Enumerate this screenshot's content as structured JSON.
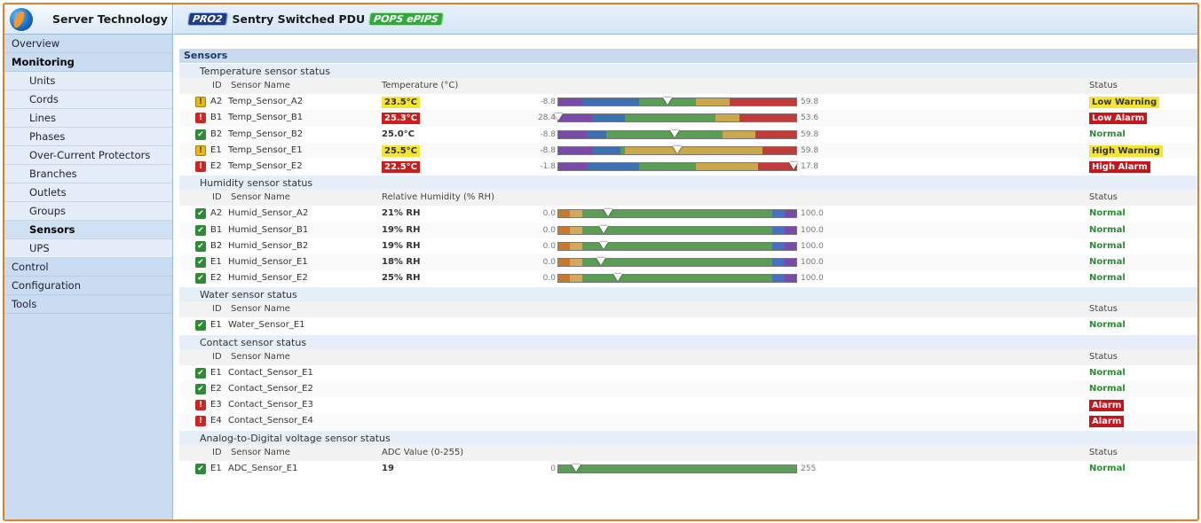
{
  "brand": {
    "name": "Server Technology"
  },
  "header": {
    "pro_badge": "PRO2",
    "product_title": "Sentry Switched PDU",
    "pips_badge": "POPS ePIPS"
  },
  "nav": [
    {
      "label": "Overview",
      "level": 0
    },
    {
      "label": "Monitoring",
      "level": 0,
      "active": true
    },
    {
      "label": "Units",
      "level": 1
    },
    {
      "label": "Cords",
      "level": 1
    },
    {
      "label": "Lines",
      "level": 1
    },
    {
      "label": "Phases",
      "level": 1
    },
    {
      "label": "Over-Current Protectors",
      "level": 1
    },
    {
      "label": "Branches",
      "level": 1
    },
    {
      "label": "Outlets",
      "level": 1
    },
    {
      "label": "Groups",
      "level": 1
    },
    {
      "label": "Sensors",
      "level": 1,
      "active": true
    },
    {
      "label": "UPS",
      "level": 1
    },
    {
      "label": "Control",
      "level": 0
    },
    {
      "label": "Configuration",
      "level": 0
    },
    {
      "label": "Tools",
      "level": 0
    }
  ],
  "sensors": {
    "title": "Sensors",
    "groups": [
      {
        "title": "Temperature sensor status",
        "headers": {
          "id": "ID",
          "name": "Sensor Name",
          "value": "Temperature (°C)",
          "status": "Status"
        },
        "rows": [
          {
            "icon": "warn",
            "id": "A2",
            "name": "Temp_Sensor_A2",
            "value": "23.5°C",
            "value_style": "warn",
            "min": "-8.8",
            "max": "59.8",
            "pointer_pct": 0.46,
            "bar": [
              [
                "#7a4aa8",
                0.1
              ],
              [
                "#3f6fb3",
                0.24
              ],
              [
                "#5a9e55",
                0.24
              ],
              [
                "#c8a84a",
                0.14
              ],
              [
                "#c33a3a",
                0.28
              ]
            ],
            "status": "Low Warning",
            "status_style": "lowwarn"
          },
          {
            "icon": "alarm",
            "id": "B1",
            "name": "Temp_Sensor_B1",
            "value": "25.3°C",
            "value_style": "alarm",
            "min": "28.4",
            "max": "53.6",
            "pointer_pct": 0.0,
            "bar": [
              [
                "#7a4aa8",
                0.14
              ],
              [
                "#3f6fb3",
                0.14
              ],
              [
                "#5a9e55",
                0.38
              ],
              [
                "#c8a84a",
                0.1
              ],
              [
                "#c33a3a",
                0.24
              ]
            ],
            "status": "Low Alarm",
            "status_style": "lowalarm"
          },
          {
            "icon": "ok",
            "id": "B2",
            "name": "Temp_Sensor_B2",
            "value": "25.0°C",
            "value_style": "plain",
            "min": "-8.8",
            "max": "59.8",
            "pointer_pct": 0.49,
            "bar": [
              [
                "#7a4aa8",
                0.12
              ],
              [
                "#3f6fb3",
                0.08
              ],
              [
                "#5a9e55",
                0.49
              ],
              [
                "#c8a84a",
                0.14
              ],
              [
                "#c33a3a",
                0.17
              ]
            ],
            "status": "Normal",
            "status_style": "normal"
          },
          {
            "icon": "warn",
            "id": "E1",
            "name": "Temp_Sensor_E1",
            "value": "25.5°C",
            "value_style": "warn",
            "min": "-8.8",
            "max": "59.8",
            "pointer_pct": 0.5,
            "bar": [
              [
                "#7a4aa8",
                0.14
              ],
              [
                "#3f6fb3",
                0.12
              ],
              [
                "#5a9e55",
                0.02
              ],
              [
                "#c8a84a",
                0.58
              ],
              [
                "#c33a3a",
                0.14
              ]
            ],
            "status": "High Warning",
            "status_style": "highwarn"
          },
          {
            "icon": "alarm",
            "id": "E2",
            "name": "Temp_Sensor_E2",
            "value": "22.5°C",
            "value_style": "alarm",
            "min": "-1.8",
            "max": "17.8",
            "pointer_pct": 0.99,
            "bar": [
              [
                "#7a4aa8",
                0.12
              ],
              [
                "#3f6fb3",
                0.22
              ],
              [
                "#5a9e55",
                0.24
              ],
              [
                "#c8a84a",
                0.26
              ],
              [
                "#c33a3a",
                0.16
              ]
            ],
            "status": "High Alarm",
            "status_style": "highalarm"
          }
        ]
      },
      {
        "title": "Humidity sensor status",
        "headers": {
          "id": "ID",
          "name": "Sensor Name",
          "value": "Relative Humidity (% RH)",
          "status": "Status"
        },
        "rows": [
          {
            "icon": "ok",
            "id": "A2",
            "name": "Humid_Sensor_A2",
            "value": "21% RH",
            "value_style": "plain",
            "min": "0.0",
            "max": "100.0",
            "pointer_pct": 0.21,
            "bar": [
              [
                "#c87a2a",
                0.05
              ],
              [
                "#d4a860",
                0.05
              ],
              [
                "#5a9e55",
                0.8
              ],
              [
                "#4a6ec0",
                0.05
              ],
              [
                "#7a4aa8",
                0.05
              ]
            ],
            "status": "Normal",
            "status_style": "normal"
          },
          {
            "icon": "ok",
            "id": "B1",
            "name": "Humid_Sensor_B1",
            "value": "19% RH",
            "value_style": "plain",
            "min": "0.0",
            "max": "100.0",
            "pointer_pct": 0.19,
            "bar": [
              [
                "#c87a2a",
                0.05
              ],
              [
                "#d4a860",
                0.05
              ],
              [
                "#5a9e55",
                0.8
              ],
              [
                "#4a6ec0",
                0.05
              ],
              [
                "#7a4aa8",
                0.05
              ]
            ],
            "status": "Normal",
            "status_style": "normal"
          },
          {
            "icon": "ok",
            "id": "B2",
            "name": "Humid_Sensor_B2",
            "value": "19% RH",
            "value_style": "plain",
            "min": "0.0",
            "max": "100.0",
            "pointer_pct": 0.19,
            "bar": [
              [
                "#c87a2a",
                0.05
              ],
              [
                "#d4a860",
                0.05
              ],
              [
                "#5a9e55",
                0.8
              ],
              [
                "#4a6ec0",
                0.05
              ],
              [
                "#7a4aa8",
                0.05
              ]
            ],
            "status": "Normal",
            "status_style": "normal"
          },
          {
            "icon": "ok",
            "id": "E1",
            "name": "Humid_Sensor_E1",
            "value": "18% RH",
            "value_style": "plain",
            "min": "0.0",
            "max": "100.0",
            "pointer_pct": 0.18,
            "bar": [
              [
                "#c87a2a",
                0.05
              ],
              [
                "#d4a860",
                0.05
              ],
              [
                "#5a9e55",
                0.8
              ],
              [
                "#4a6ec0",
                0.05
              ],
              [
                "#7a4aa8",
                0.05
              ]
            ],
            "status": "Normal",
            "status_style": "normal"
          },
          {
            "icon": "ok",
            "id": "E2",
            "name": "Humid_Sensor_E2",
            "value": "25% RH",
            "value_style": "plain",
            "min": "0.0",
            "max": "100.0",
            "pointer_pct": 0.25,
            "bar": [
              [
                "#c87a2a",
                0.05
              ],
              [
                "#d4a860",
                0.05
              ],
              [
                "#5a9e55",
                0.8
              ],
              [
                "#4a6ec0",
                0.05
              ],
              [
                "#7a4aa8",
                0.05
              ]
            ],
            "status": "Normal",
            "status_style": "normal"
          }
        ]
      },
      {
        "title": "Water sensor status",
        "headers": {
          "id": "ID",
          "name": "Sensor Name",
          "value": "",
          "status": "Status"
        },
        "rows": [
          {
            "icon": "ok",
            "id": "E1",
            "name": "Water_Sensor_E1",
            "status": "Normal",
            "status_style": "normal"
          }
        ]
      },
      {
        "title": "Contact sensor status",
        "headers": {
          "id": "ID",
          "name": "Sensor Name",
          "value": "",
          "status": "Status"
        },
        "rows": [
          {
            "icon": "ok",
            "id": "E1",
            "name": "Contact_Sensor_E1",
            "status": "Normal",
            "status_style": "normal"
          },
          {
            "icon": "ok",
            "id": "E2",
            "name": "Contact_Sensor_E2",
            "status": "Normal",
            "status_style": "normal"
          },
          {
            "icon": "alarm",
            "id": "E3",
            "name": "Contact_Sensor_E3",
            "status": "Alarm",
            "status_style": "alarm"
          },
          {
            "icon": "alarm",
            "id": "E4",
            "name": "Contact_Sensor_E4",
            "status": "Alarm",
            "status_style": "alarm"
          }
        ]
      },
      {
        "title": "Analog-to-Digital voltage sensor status",
        "headers": {
          "id": "ID",
          "name": "Sensor Name",
          "value": "ADC Value (0-255)",
          "status": "Status"
        },
        "rows": [
          {
            "icon": "ok",
            "id": "E1",
            "name": "ADC_Sensor_E1",
            "value": "19",
            "value_style": "plain",
            "min": "0",
            "max": "255",
            "pointer_pct": 0.075,
            "bar": [
              [
                "#5a9e55",
                1.0
              ]
            ],
            "status": "Normal",
            "status_style": "normal"
          }
        ]
      }
    ]
  }
}
